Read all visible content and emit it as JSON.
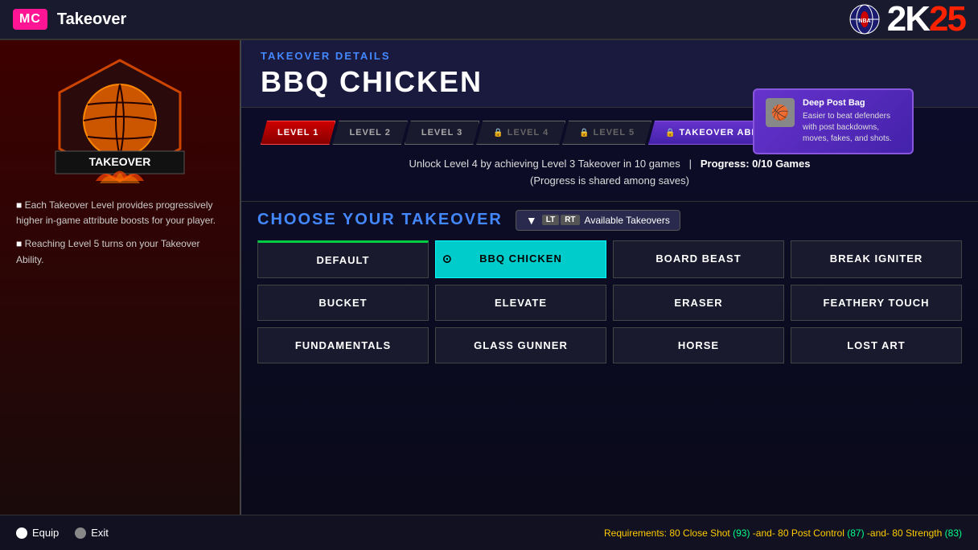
{
  "topbar": {
    "mc_label": "MC",
    "title": "Takeover",
    "logo_text": "2K25"
  },
  "details": {
    "section_label": "TAKEOVER DETAILS",
    "takeover_name": "BBQ CHICKEN",
    "ability_card": {
      "title": "Deep Post Bag",
      "description": "Easier to beat defenders with post backdowns, moves, fakes, and shots."
    }
  },
  "levels": [
    {
      "label": "LEVEL 1",
      "locked": false,
      "active": true
    },
    {
      "label": "LEVEL 2",
      "locked": false,
      "active": false
    },
    {
      "label": "LEVEL 3",
      "locked": false,
      "active": false
    },
    {
      "label": "LEVEL 4",
      "locked": true,
      "active": false
    },
    {
      "label": "LEVEL 5",
      "locked": true,
      "active": false
    },
    {
      "label": "TAKEOVER ABILITY",
      "locked": true,
      "active": false,
      "special": true
    }
  ],
  "progress": {
    "message": "Unlock Level 4 by achieving Level 3 Takeover in 10 games",
    "separator": "|",
    "progress_label": "Progress: 0/10 Games",
    "shared_note": "(Progress is shared among saves)"
  },
  "choose_section": {
    "title": "CHOOSE YOUR TAKEOVER",
    "filter_label": "Available Takeovers",
    "filter_tags": [
      "LT",
      "RT"
    ]
  },
  "takeovers": [
    {
      "label": "DEFAULT",
      "selected": false,
      "default_marker": true,
      "col": 0
    },
    {
      "label": "BBQ CHICKEN",
      "selected": true,
      "col": 1
    },
    {
      "label": "BOARD BEAST",
      "selected": false,
      "col": 2
    },
    {
      "label": "BREAK IGNITER",
      "selected": false,
      "col": 3
    },
    {
      "label": "BUCKET",
      "selected": false,
      "col": 0
    },
    {
      "label": "ELEVATE",
      "selected": false,
      "col": 1
    },
    {
      "label": "ERASER",
      "selected": false,
      "col": 2
    },
    {
      "label": "FEATHERY TOUCH",
      "selected": false,
      "col": 3
    },
    {
      "label": "FUNDAMENTALS",
      "selected": false,
      "col": 0
    },
    {
      "label": "GLASS GUNNER",
      "selected": false,
      "col": 1
    },
    {
      "label": "HORSE",
      "selected": false,
      "col": 2
    },
    {
      "label": "LOST ART",
      "selected": false,
      "col": 3
    }
  ],
  "bottom": {
    "equip_label": "Equip",
    "exit_label": "Exit",
    "requirements_label": "Requirements:",
    "req1_stat": "80 Close Shot",
    "req1_value": "(93)",
    "req2_stat": "80 Post Control",
    "req2_value": "(87)",
    "req3_stat": "80 Strength",
    "req3_value": "(83)",
    "and_text": "-and-"
  }
}
